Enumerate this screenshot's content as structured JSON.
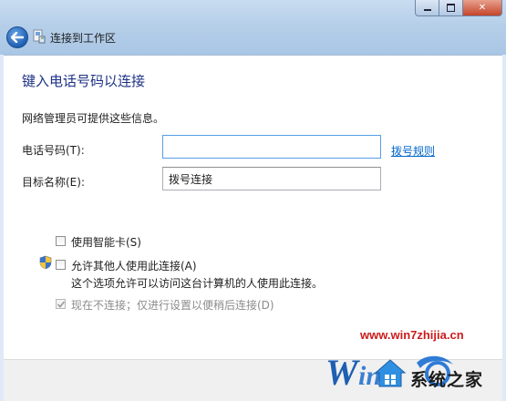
{
  "window": {
    "title": "连接到工作区",
    "controls": [
      "minimize",
      "maximize",
      "close"
    ],
    "close_glyph": "✕"
  },
  "page": {
    "heading": "键入电话号码以连接",
    "info": "网络管理员可提供这些信息。"
  },
  "form": {
    "phone_label": "电话号码(T):",
    "phone_value": "",
    "dial_rules_link": "拨号规则",
    "destination_label": "目标名称(E):",
    "destination_value": "拨号连接"
  },
  "options": {
    "smartcard": {
      "label": "使用智能卡(S)",
      "checked": false
    },
    "allow_others": {
      "label": "允许其他人使用此连接(A)",
      "checked": false,
      "note": "这个选项允许可以访问这台计算机的人使用此连接。"
    },
    "dont_connect": {
      "label": "现在不连接；仅进行设置以便稍后连接(D)",
      "checked": true,
      "disabled": true
    }
  },
  "watermark": {
    "url": "www.win7zhijia.cn",
    "site": "系统之家"
  },
  "colors": {
    "heading": "#1e3287",
    "link": "#0066cc",
    "watermark_url": "#cc1b1b"
  },
  "icons": [
    "back-arrow-icon",
    "network-wizard-icon",
    "uac-shield-icon",
    "checkmark-icon"
  ]
}
